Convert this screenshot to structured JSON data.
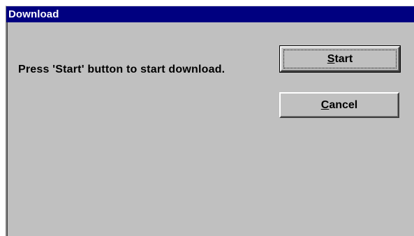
{
  "window": {
    "title": "Download"
  },
  "dialog": {
    "message": "Press 'Start' button to start download."
  },
  "buttons": {
    "start": {
      "mnemonic": "S",
      "rest": "tart"
    },
    "cancel": {
      "mnemonic": "C",
      "rest": "ancel"
    }
  },
  "colors": {
    "titlebar": "#000080",
    "titlebar_text": "#ffffff",
    "face": "#c0c0c0"
  }
}
